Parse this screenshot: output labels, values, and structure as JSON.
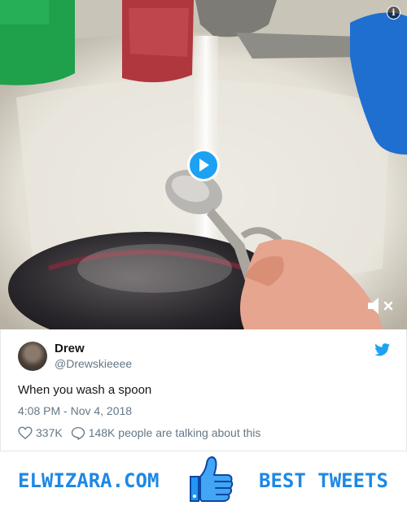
{
  "tweet": {
    "name": "Drew",
    "handle": "@Drewskieeee",
    "text": "When you wash a spoon",
    "timestamp": "4:08 PM - Nov 4, 2018",
    "likes": "337K",
    "talking": "148K people are talking about this"
  },
  "banner": {
    "site": "ELWIZARA.COM",
    "tagline": "BEST TWEETS"
  },
  "icons": {
    "info": "i",
    "play": "play-icon",
    "mute": "muted-speaker-icon",
    "bird": "twitter-bird-icon",
    "like": "heart-icon",
    "reply": "speech-bubble-icon",
    "thumb": "thumbs-up-icon"
  },
  "colors": {
    "accent": "#1da1f2",
    "brand": "#1e88e5",
    "muted_text": "#657786"
  }
}
